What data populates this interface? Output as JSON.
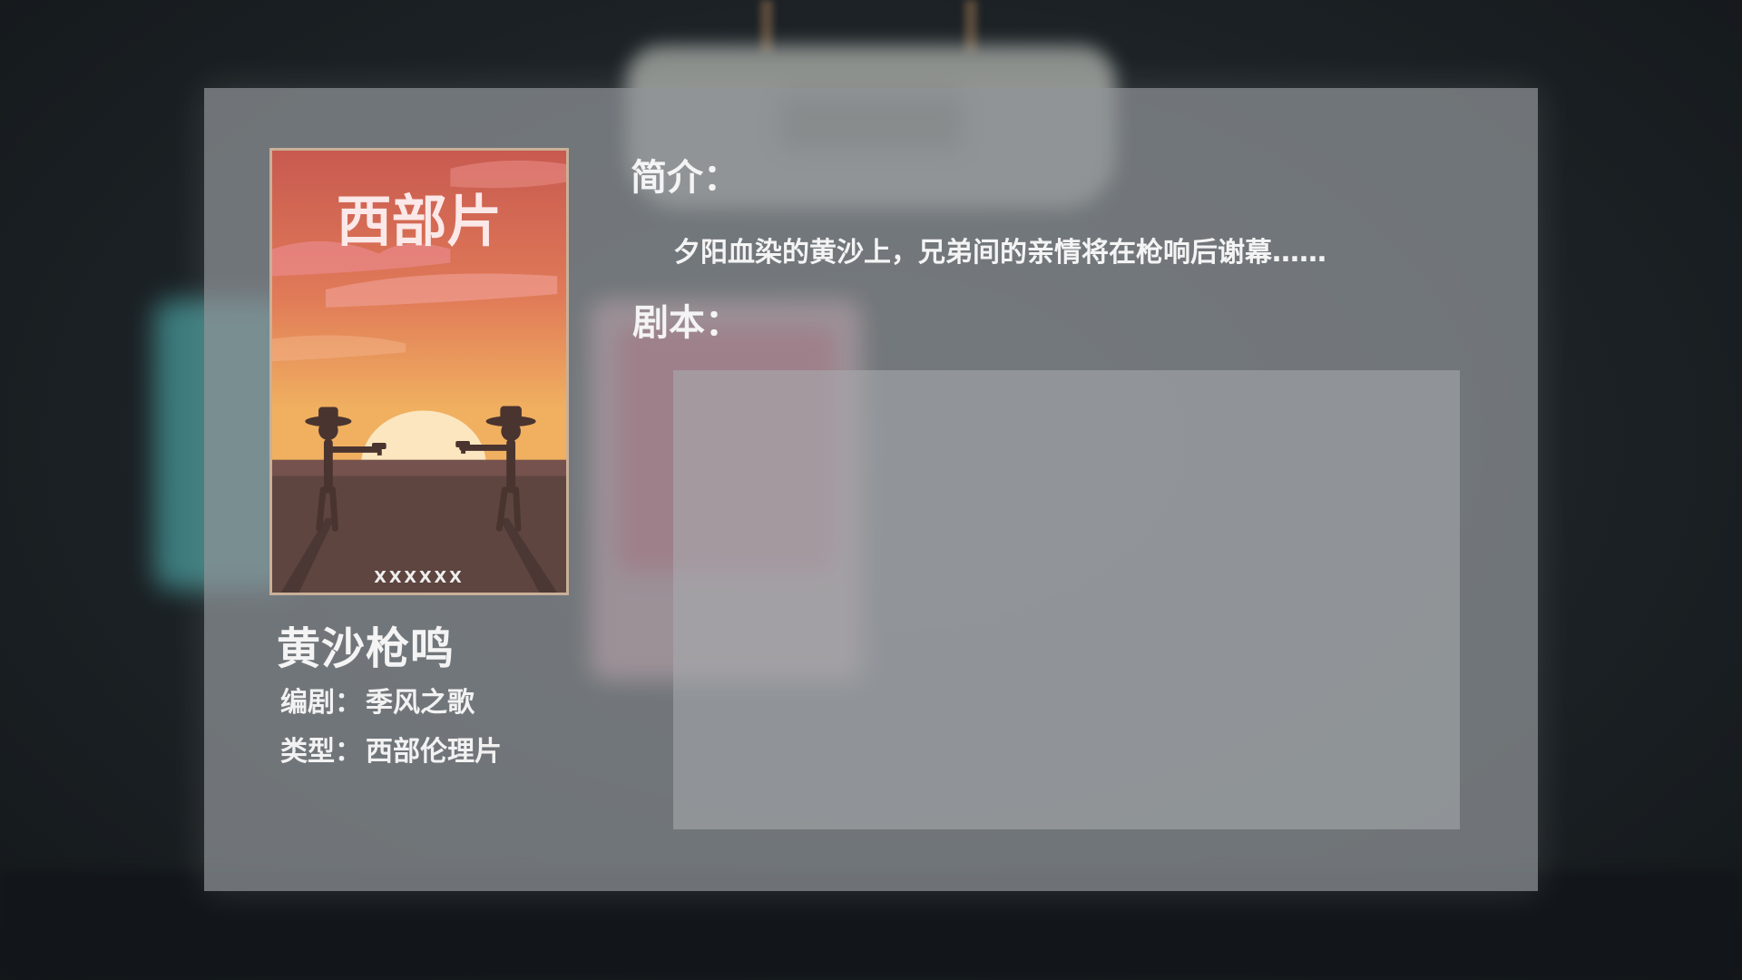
{
  "background": {
    "wall_color": "#1b2024",
    "panel_color": "#92969a"
  },
  "poster": {
    "title_art": "西部片",
    "bottom_text": "XXXXXX",
    "sky_top_color": "#c85a50",
    "sky_bottom_color": "#f0b060",
    "ground_color": "#5e4540"
  },
  "movie": {
    "title": "黄沙枪鸣",
    "writer_label": "编剧：",
    "writer": "季风之歌",
    "genre_label": "类型：",
    "genre": "西部伦理片"
  },
  "intro": {
    "label": "简介：",
    "text": "夕阳血染的黄沙上，兄弟间的亲情将在枪响后谢幕……"
  },
  "script": {
    "label": "剧本："
  }
}
